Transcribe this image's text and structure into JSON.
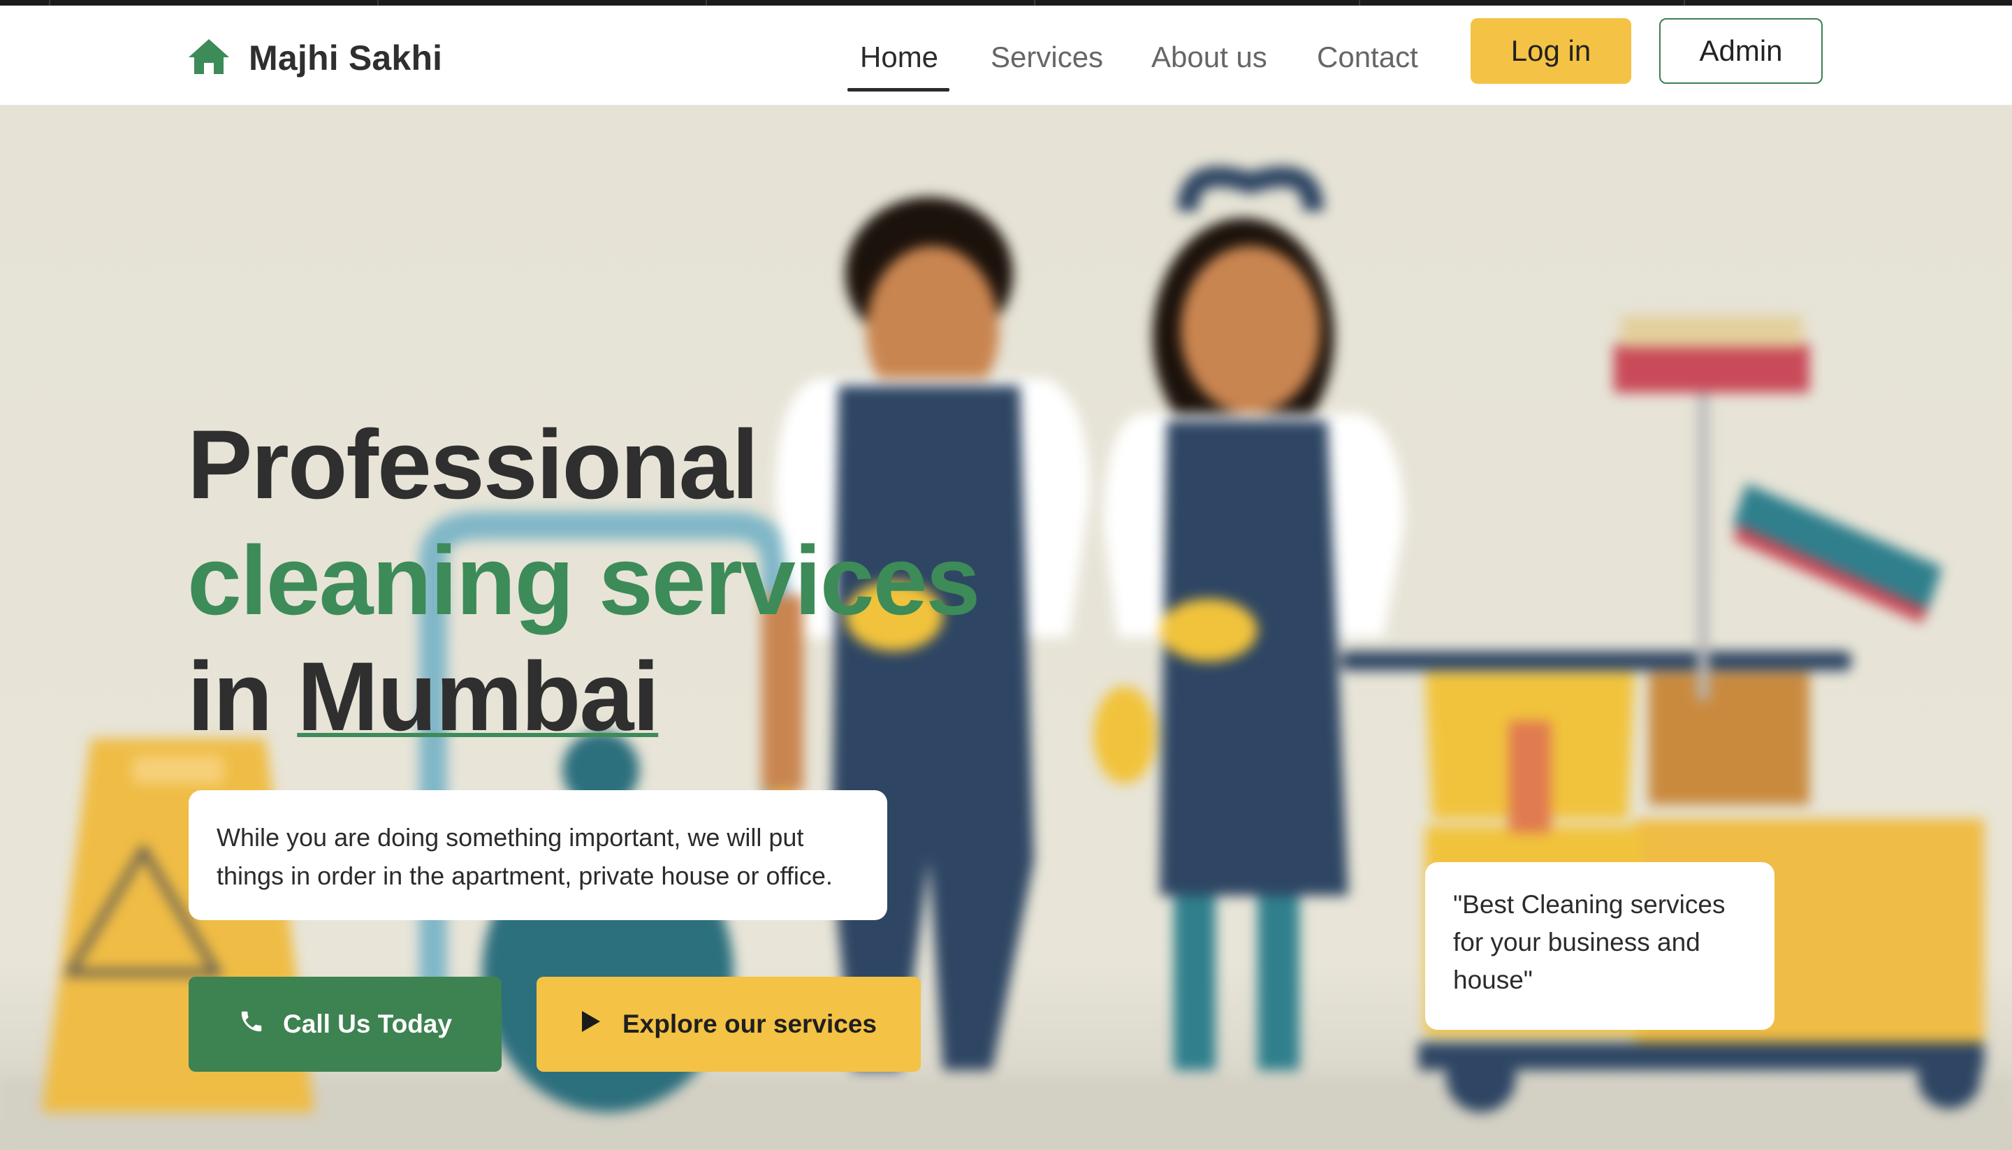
{
  "brand": {
    "name": "Majhi Sakhi",
    "icon": "home-icon",
    "color": "#3d8b58"
  },
  "nav": {
    "items": [
      {
        "label": "Home",
        "active": true
      },
      {
        "label": "Services",
        "active": false
      },
      {
        "label": "About us",
        "active": false
      },
      {
        "label": "Contact",
        "active": false
      }
    ],
    "login_label": "Log in",
    "admin_label": "Admin"
  },
  "hero": {
    "headline": {
      "line1": "Professional",
      "line2": "cleaning services",
      "line3_prefix": "in ",
      "line3_city": "Mumbai"
    },
    "description": "While you are doing something important, we will put things in order in the apartment, private house or office.",
    "call_button": {
      "label": "Call Us Today",
      "icon": "phone-icon"
    },
    "explore_button": {
      "label": "Explore our services",
      "icon": "play-icon"
    },
    "quote": "\"Best Cleaning services for your business and house\""
  },
  "colors": {
    "accent_green": "#3d8251",
    "accent_yellow": "#f4c244",
    "text_dark": "#2f2f2f",
    "hero_background": "#e6e3d6"
  }
}
